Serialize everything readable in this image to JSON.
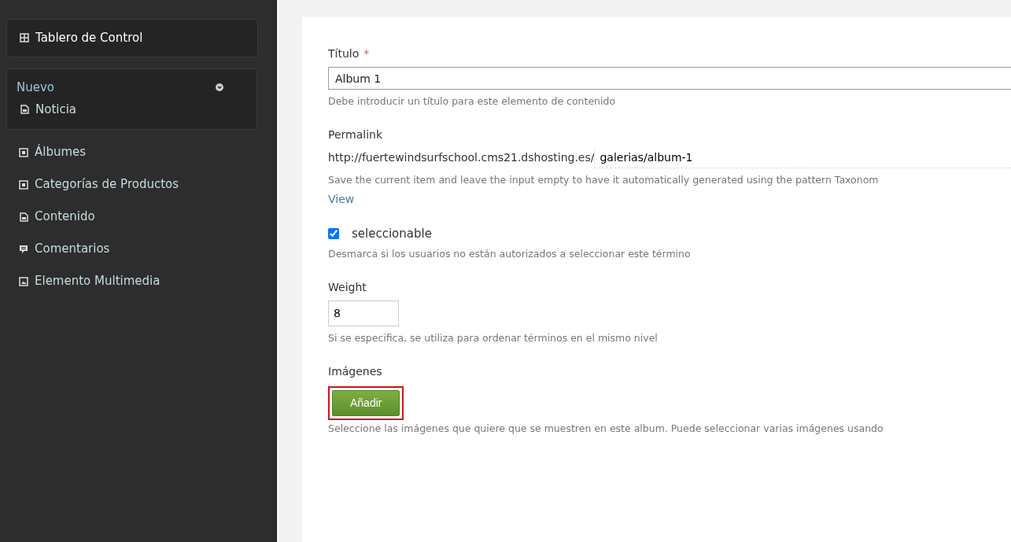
{
  "sidebar": {
    "dashboard": {
      "label": "Tablero de Control",
      "kind": "grid"
    },
    "new_menu": {
      "label": "Nuevo",
      "expanded": true,
      "items": [
        {
          "label": "Noticia",
          "kind": "document"
        }
      ]
    },
    "items": [
      {
        "label": "Álbumes",
        "kind": "square"
      },
      {
        "label": "Categorías de Productos",
        "kind": "square"
      },
      {
        "label": "Contenido",
        "kind": "document"
      },
      {
        "label": "Comentarios",
        "kind": "comment"
      },
      {
        "label": "Elemento Multimedia",
        "kind": "image"
      }
    ]
  },
  "form": {
    "title": {
      "label": "Título",
      "required_mark": "*",
      "value": "Album 1",
      "help": "Debe introducir un título para este elemento de contenido"
    },
    "permalink": {
      "label": "Permalink",
      "prefix": "http://fuertewindsurfschool.cms21.dshosting.es/",
      "value": "galerias/album-1",
      "help": "Save the current item and leave the input empty to have it automatically generated using the pattern Taxonom",
      "link": "View"
    },
    "selectable": {
      "label": "seleccionable",
      "checked": true,
      "help": "Desmarca si los usuarios no están autorizados a seleccionar este término"
    },
    "weight": {
      "label": "Weight",
      "value": "8",
      "help": "Si se especifica, se utiliza para ordenar términos en el mismo nivel"
    },
    "images": {
      "label": "Imágenes",
      "button": "Añadir",
      "highlighted": true,
      "help": "Seleccione las imágenes que quiere que se muestren en este album. Puede seleccionar varias imágenes usando"
    }
  }
}
